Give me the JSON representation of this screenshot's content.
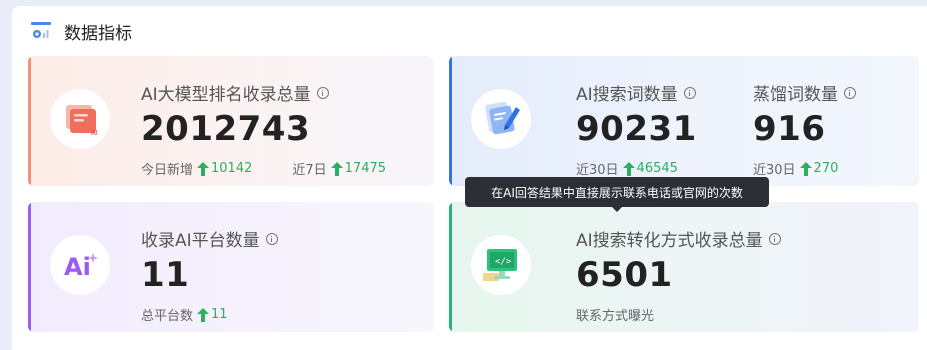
{
  "header": {
    "title": "数据指标"
  },
  "cards": [
    {
      "metric": {
        "label": "AI大模型排名收录总量",
        "value": "2012743",
        "sub": [
          {
            "label": "今日新增",
            "value": "10142"
          },
          {
            "label": "近7日",
            "value": "17475"
          }
        ]
      }
    },
    {
      "metrics": [
        {
          "label": "AI搜索词数量",
          "value": "90231",
          "sub_label": "近30日",
          "sub_value": "46545"
        },
        {
          "label": "蒸馏词数量",
          "value": "916",
          "sub_label": "近30日",
          "sub_value": "270"
        }
      ]
    },
    {
      "metric": {
        "label": "收录AI平台数量",
        "value": "11",
        "sub_label": "总平台数",
        "sub_value": "11"
      }
    },
    {
      "metric": {
        "label": "AI搜索转化方式收录总量",
        "value": "6501",
        "sub_label": "联系方式曝光"
      }
    }
  ],
  "tooltip": {
    "text": "在AI回答结果中直接展示联系电话或官网的次数"
  },
  "colors": {
    "up": "#2fae5f",
    "card1_accent": "#f2907a",
    "card2_accent": "#2f73e8",
    "card3_accent": "#9b5df0",
    "card4_accent": "#22b573"
  },
  "icons": [
    "dashboard-icon",
    "ranking-doc-icon",
    "search-pen-icon",
    "ai-logo-icon",
    "monitor-code-icon",
    "info-icon",
    "up-arrow-icon"
  ]
}
